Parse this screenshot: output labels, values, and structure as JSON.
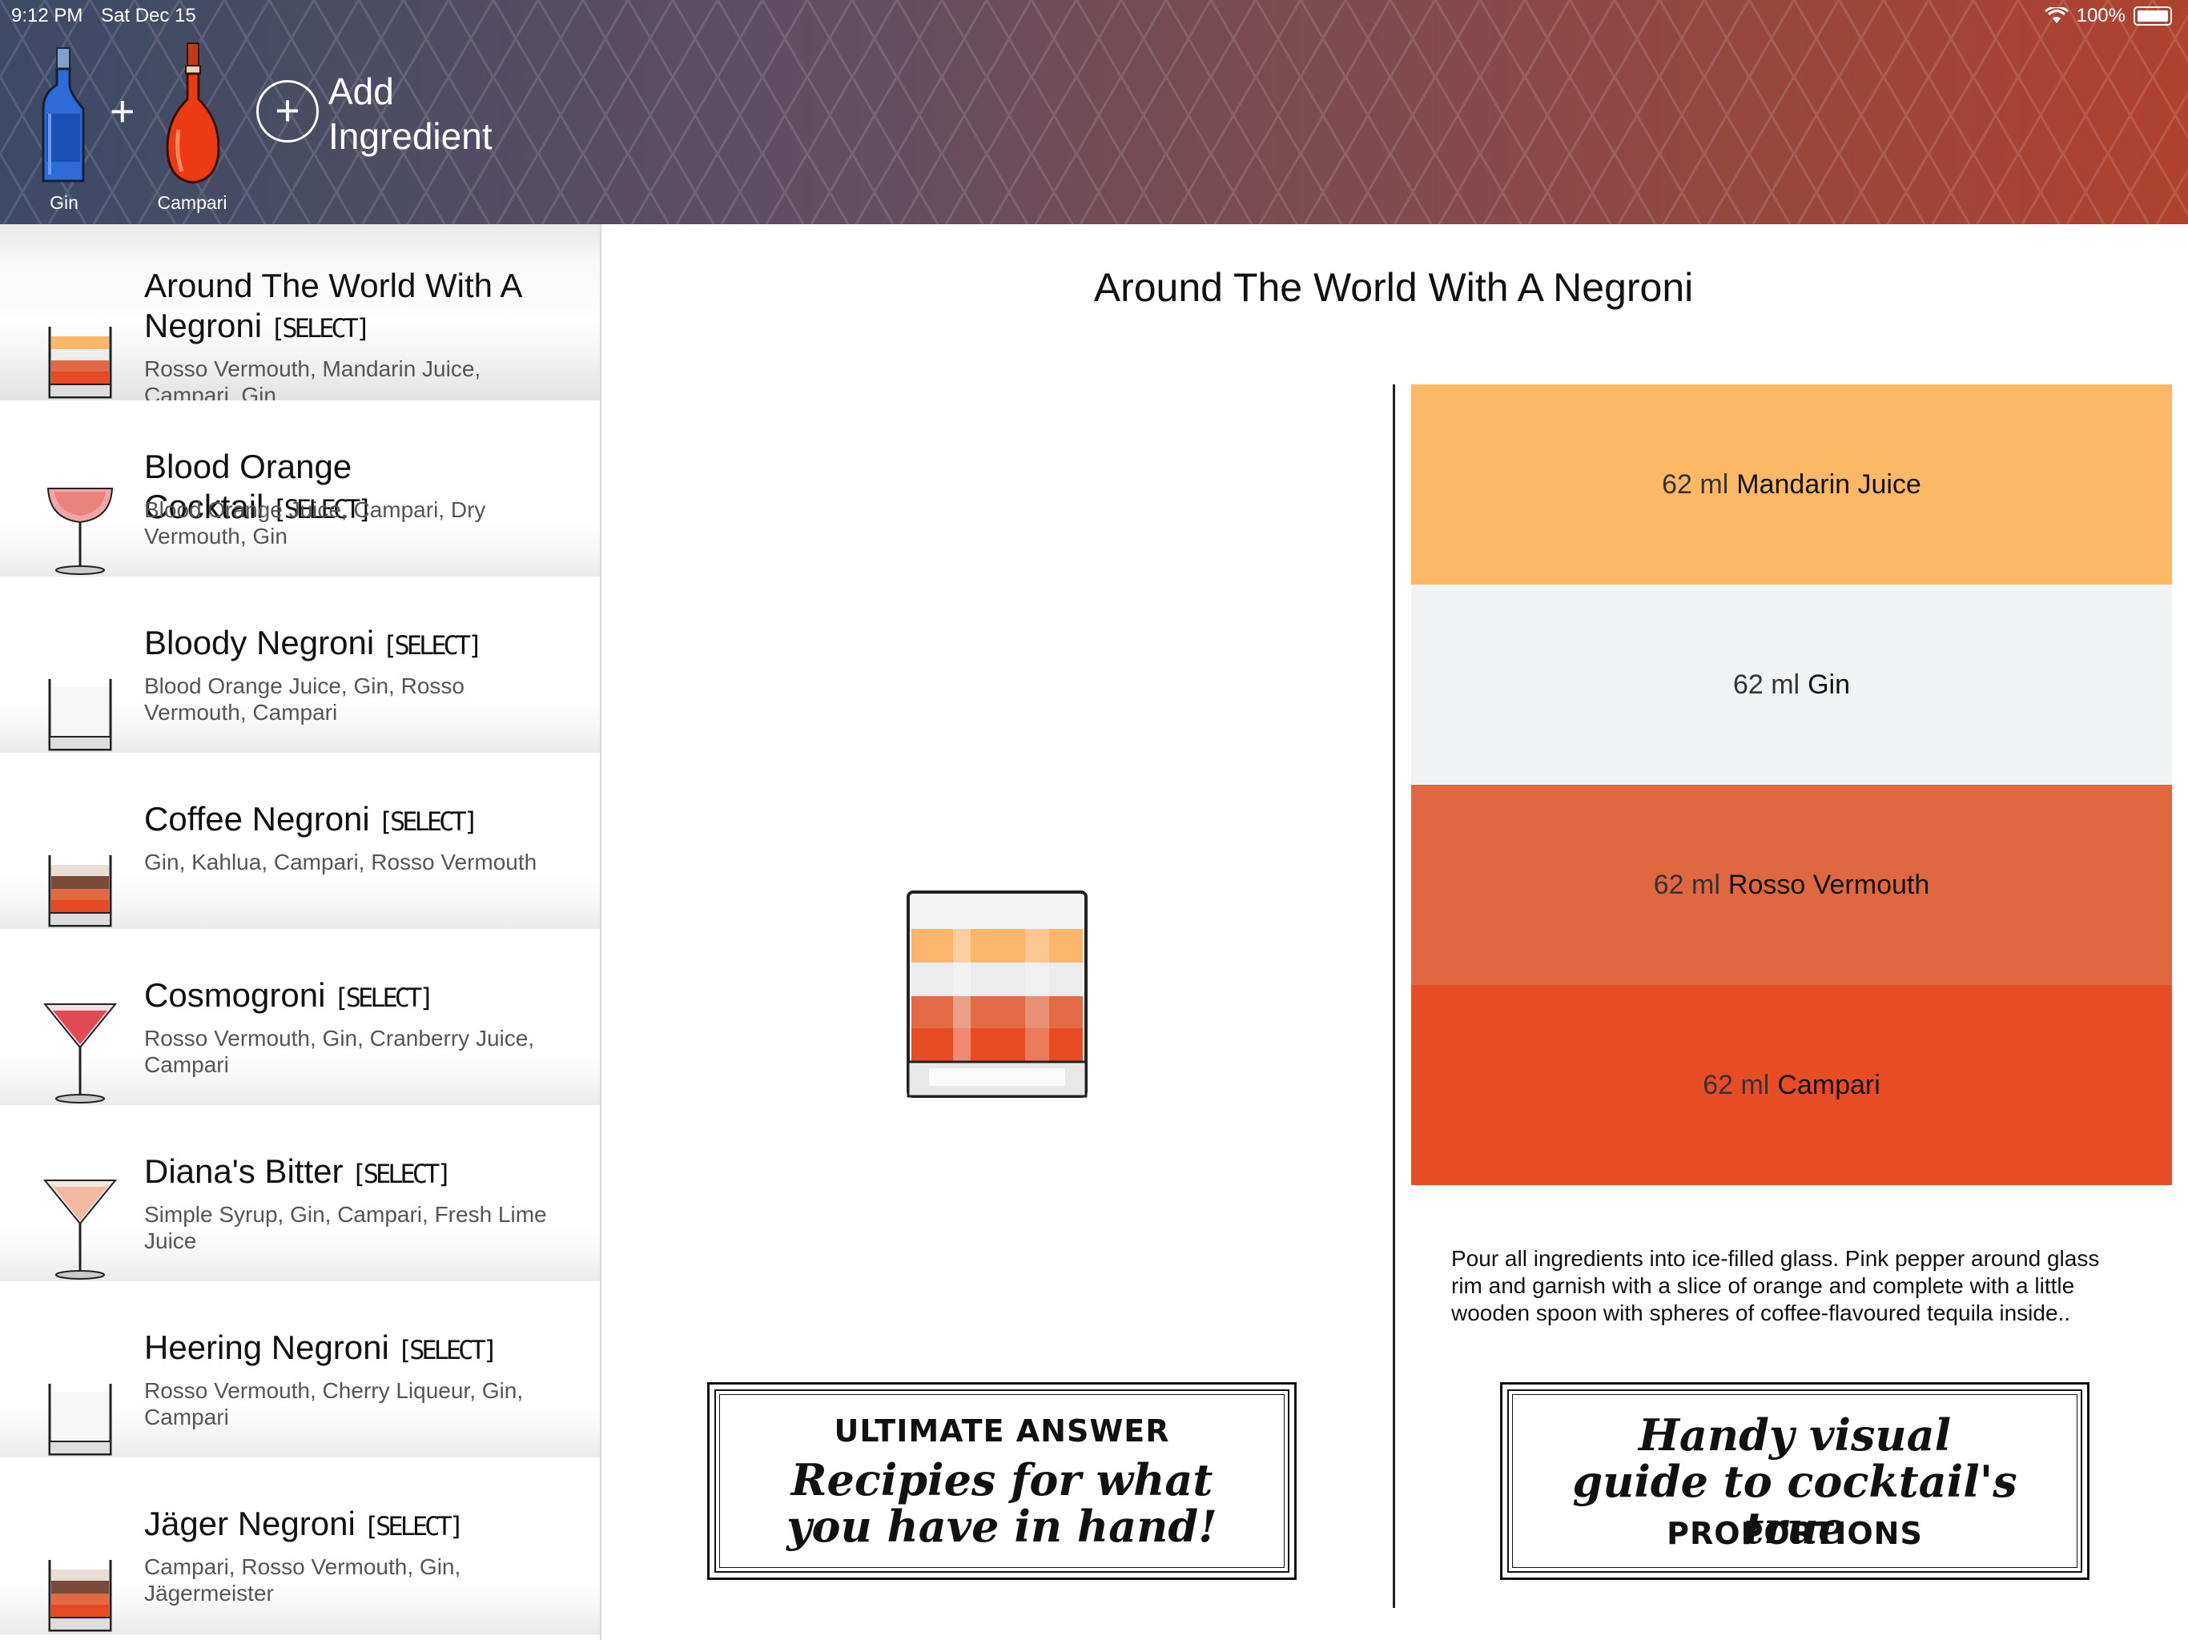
{
  "status_bar": {
    "time": "9:12 PM",
    "date": "Sat Dec 15",
    "battery": "100%"
  },
  "header": {
    "ingredients": [
      {
        "label": "Gin"
      },
      {
        "label": "Campari"
      }
    ],
    "add_label": "Add\nIngredient"
  },
  "sidebar": {
    "items": [
      {
        "title": "Around The World With A Negroni",
        "badge": "[SELECT]",
        "ingredients": "Rosso Vermouth, Mandarin Juice, Campari, Gin",
        "glass": "rocks-layered"
      },
      {
        "title": "Blood Orange Cocktail",
        "badge": "[SELECT]",
        "ingredients": "Blood Orange Juice, Campari, Dry Vermouth, Gin",
        "glass": "coupe-pink"
      },
      {
        "title": "Bloody Negroni",
        "badge": "[SELECT]",
        "ingredients": "Blood Orange Juice, Gin, Rosso Vermouth, Campari",
        "glass": "rocks-empty"
      },
      {
        "title": "Coffee Negroni",
        "badge": "[SELECT]",
        "ingredients": "Gin, Kahlua, Campari, Rosso Vermouth",
        "glass": "rocks-coffee"
      },
      {
        "title": "Cosmogroni",
        "badge": "[SELECT]",
        "ingredients": "Rosso Vermouth, Gin, Cranberry Juice, Campari",
        "glass": "martini-red"
      },
      {
        "title": "Diana's Bitter",
        "badge": "[SELECT]",
        "ingredients": "Simple Syrup, Gin, Campari, Fresh Lime Juice",
        "glass": "martini-peach"
      },
      {
        "title": "Heering Negroni",
        "badge": "[SELECT]",
        "ingredients": "Rosso Vermouth, Cherry Liqueur, Gin, Campari",
        "glass": "rocks-empty"
      },
      {
        "title": "Jäger Negroni",
        "badge": "[SELECT]",
        "ingredients": "Campari, Rosso Vermouth, Gin, Jägermeister",
        "glass": "rocks-coffee"
      }
    ]
  },
  "detail": {
    "title": "Around The World With A Negroni",
    "proportions": [
      {
        "amount": "62 ml",
        "name": "Mandarin Juice",
        "color": "#fdb866"
      },
      {
        "amount": "62 ml",
        "name": "Gin",
        "color": "#f1f2f3"
      },
      {
        "amount": "62 ml",
        "name": "Rosso Vermouth",
        "color": "#e06840"
      },
      {
        "amount": "62 ml",
        "name": "Campari",
        "color": "#e84c24"
      }
    ],
    "instructions": "Pour all ingredients into ice-filled glass. Pink pepper around glass rim and garnish with a slice of orange and complete with a little wooden spoon with spheres of coffee-flavoured tequila inside.."
  },
  "promos": {
    "left": {
      "top": "ULTIMATE ANSWER",
      "script": "Recipies for what you have in hand!"
    },
    "right": {
      "script": "Handy visual guide to cocktail's true",
      "bottom": "PROPORTIONS"
    }
  }
}
